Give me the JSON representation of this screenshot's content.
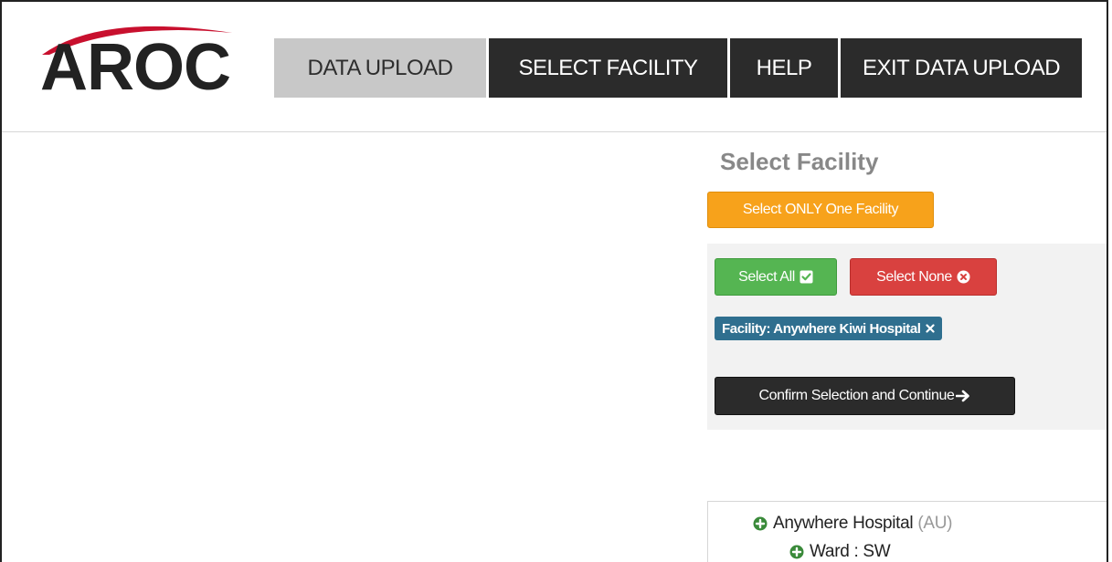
{
  "brand": {
    "logo_text": "AROC",
    "arc_color": "#c8102e"
  },
  "nav": {
    "items": [
      {
        "label": "DATA UPLOAD",
        "active": true
      },
      {
        "label": "SELECT FACILITY",
        "active": false
      },
      {
        "label": "HELP",
        "active": false
      },
      {
        "label": "EXIT DATA UPLOAD",
        "active": false
      }
    ]
  },
  "main": {
    "title": "Select Facility",
    "only_one_label": "Select ONLY One Facility",
    "select_all_label": "Select All",
    "select_none_label": "Select None",
    "facility_tag": "Facility: Anywhere Kiwi Hospital",
    "confirm_label": "Confirm Selection and Continue"
  },
  "tree": {
    "items": [
      {
        "label": "Anywhere Hospital",
        "suffix": "(AU)"
      },
      {
        "label": "Ward : SW",
        "suffix": ""
      }
    ]
  },
  "colors": {
    "orange": "#f7a21b",
    "green": "#55b552",
    "red": "#d9413f",
    "tag_blue": "#2f6f8f",
    "dark": "#2b2b2b",
    "plus_green": "#3a8a3a"
  }
}
